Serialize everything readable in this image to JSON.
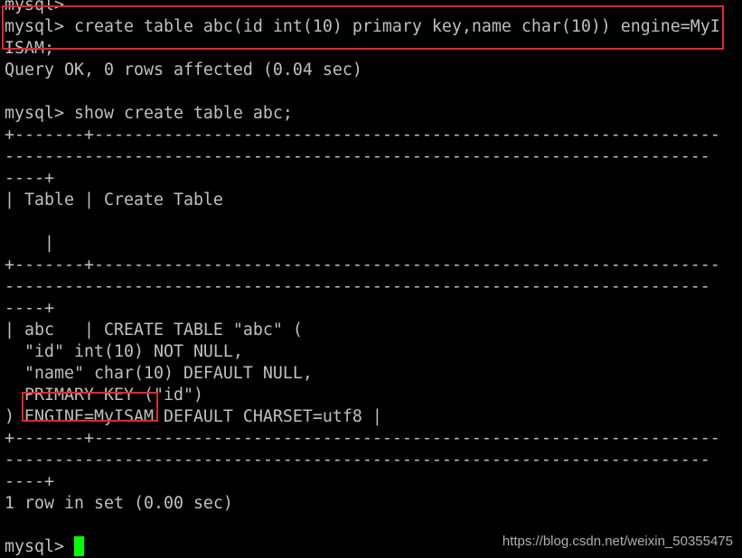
{
  "terminal": {
    "lines": [
      "mysql>",
      "mysql> create table abc(id int(10) primary key,name char(10)) engine=MyI",
      "ISAM;",
      "Query OK, 0 rows affected (0.04 sec)",
      "",
      "mysql> show create table abc;",
      "+-------+---------------------------------------------------------------",
      "-----------------------------------------------------------------------",
      "----+",
      "| Table | Create Table",
      "",
      "    |",
      "+-------+---------------------------------------------------------------",
      "-----------------------------------------------------------------------",
      "----+",
      "| abc   | CREATE TABLE \"abc\" (",
      "  \"id\" int(10) NOT NULL,",
      "  \"name\" char(10) DEFAULT NULL,",
      "  PRIMARY KEY (\"id\")",
      ") ENGINE=MyISAM DEFAULT CHARSET=utf8 |",
      "+-------+---------------------------------------------------------------",
      "-----------------------------------------------------------------------",
      "----+",
      "1 row in set (0.00 sec)",
      ""
    ],
    "prompt": "mysql> ",
    "cursor_color": "#00ff00",
    "highlight_color": "#e8242c"
  },
  "watermark": "https://blog.csdn.net/weixin_50355475"
}
